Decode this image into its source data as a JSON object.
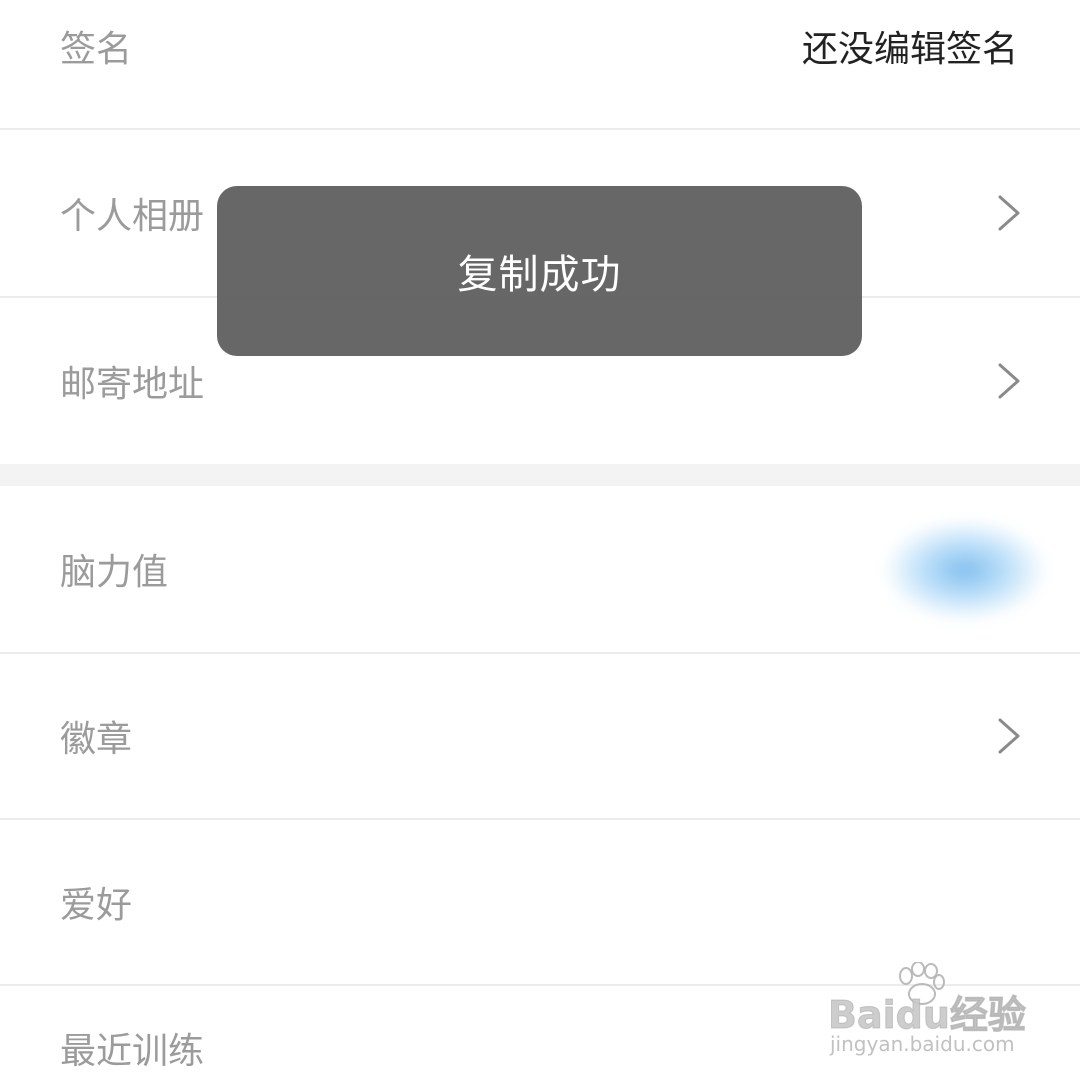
{
  "profile_rows": [
    {
      "label": "签名",
      "value": "还没编辑签名"
    },
    {
      "label": "个人相册"
    },
    {
      "label": "邮寄地址"
    },
    {
      "label": "脑力值"
    },
    {
      "label": "徽章"
    },
    {
      "label": "爱好"
    },
    {
      "label": "最近训练"
    }
  ],
  "icons": {
    "chevron": "chevron-right-icon",
    "watermark_paw": "paw-icon"
  },
  "toast": {
    "message": "复制成功"
  },
  "watermark": {
    "logo": "Baidu经验",
    "url": "jingyan.baidu.com"
  },
  "colors": {
    "label": "#9b9b9b",
    "value": "#222222",
    "toast_bg": "#5a5a5a",
    "toast_text": "#ffffff",
    "divider": "#ececec",
    "section_gap": "#f3f3f3",
    "blurred_badge": "#6eb4eb"
  }
}
